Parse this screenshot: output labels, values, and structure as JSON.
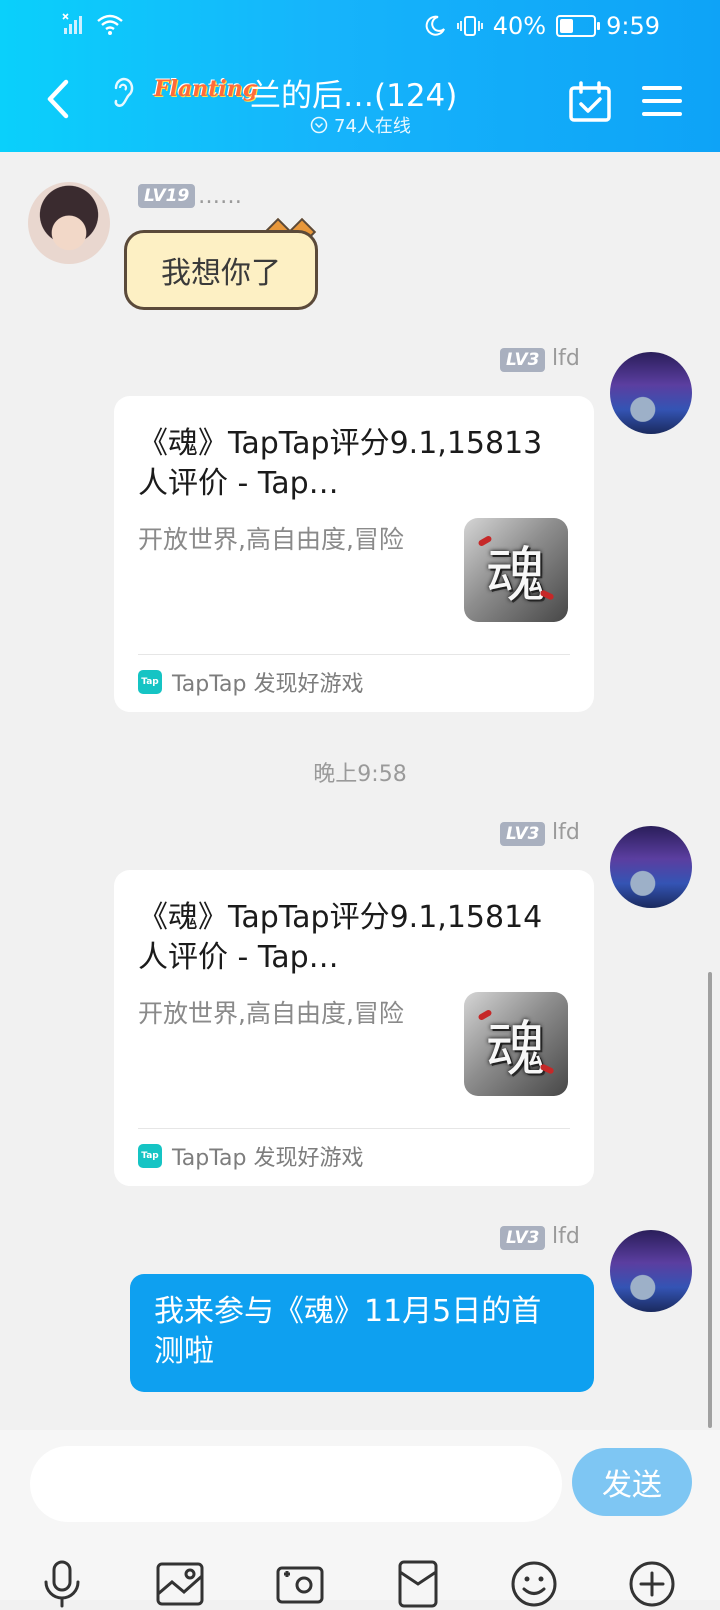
{
  "status_bar": {
    "battery": "40%",
    "battery_level": 0.4,
    "time": "9:59"
  },
  "header": {
    "group_logo": "Flanting",
    "group_title": "兰的后…(124)",
    "online_count": "74人在线"
  },
  "messages": [
    {
      "type": "text",
      "side": "left",
      "level": "LV19",
      "sender": "……",
      "text": "我想你了"
    },
    {
      "type": "card",
      "side": "right",
      "level": "LV3",
      "sender": "lfd",
      "title": "《魂》TapTap评分9.1,15813 人评价 - Tap…",
      "description": "开放世界,高自由度,冒险",
      "thumb_text": "魂",
      "source": "TapTap 发现好游戏",
      "source_icon": "Tap"
    },
    {
      "type": "time",
      "text": "晚上9:58"
    },
    {
      "type": "card",
      "side": "right",
      "level": "LV3",
      "sender": "lfd",
      "title": "《魂》TapTap评分9.1,15814 人评价 - Tap…",
      "description": "开放世界,高自由度,冒险",
      "thumb_text": "魂",
      "source": "TapTap 发现好游戏",
      "source_icon": "Tap"
    },
    {
      "type": "text",
      "side": "right",
      "level": "LV3",
      "sender": "lfd",
      "text": "我来参与《魂》11月5日的首测啦"
    }
  ],
  "composer": {
    "input_value": "",
    "send_label": "发送"
  },
  "toolbar": [
    {
      "icon": "microphone-icon"
    },
    {
      "icon": "image-icon"
    },
    {
      "icon": "camera-icon"
    },
    {
      "icon": "red-packet-icon"
    },
    {
      "icon": "emoji-icon"
    },
    {
      "icon": "plus-icon"
    }
  ],
  "colors": {
    "header_gradient_start": "#0ad0fb",
    "header_gradient_end": "#0ea3f7",
    "sent_bubble": "#0ea0f0",
    "send_button": "#7ec6f3",
    "background": "#f1f1f1"
  }
}
